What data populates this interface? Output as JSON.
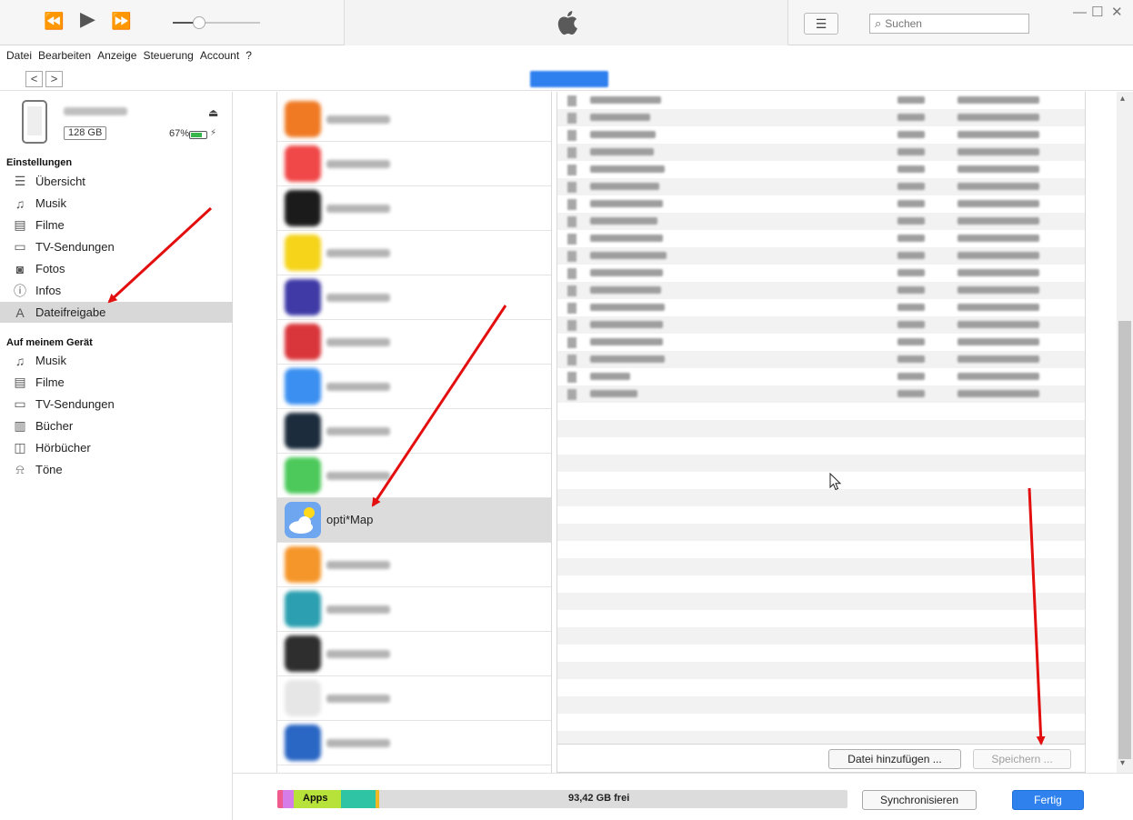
{
  "window": {
    "controls": {
      "minimize": "—",
      "maximize": "☐",
      "close": "✕"
    }
  },
  "toolbar": {
    "rewind_icon": "⏪",
    "play_icon": "▶",
    "forward_icon": "⏩",
    "volume_level": 0.3,
    "list_view_icon": "☰",
    "search": {
      "icon": "⌕",
      "placeholder": "Suchen"
    }
  },
  "menu": [
    "Datei",
    "Bearbeiten",
    "Anzeige",
    "Steuerung",
    "Account",
    "?"
  ],
  "nav": {
    "back": "<",
    "forward": ">"
  },
  "device": {
    "capacity": "128 GB",
    "battery": "67%",
    "battery_level": 0.67,
    "eject_icon": "⏏",
    "charge_icon": "⚡"
  },
  "sidebar": {
    "settings_heading": "Einstellungen",
    "settings_items": [
      {
        "label": "Übersicht",
        "icon": "summary-icon",
        "glyph": "☰"
      },
      {
        "label": "Musik",
        "icon": "music-icon",
        "glyph": "♫"
      },
      {
        "label": "Filme",
        "icon": "film-icon",
        "glyph": "▤"
      },
      {
        "label": "TV-Sendungen",
        "icon": "tv-icon",
        "glyph": "▭"
      },
      {
        "label": "Fotos",
        "icon": "camera-icon",
        "glyph": "◙"
      },
      {
        "label": "Infos",
        "icon": "info-icon",
        "glyph": "ⓘ"
      },
      {
        "label": "Dateifreigabe",
        "icon": "app-store-icon",
        "glyph": "A",
        "selected": true
      }
    ],
    "device_heading": "Auf meinem Gerät",
    "device_items": [
      {
        "label": "Musik",
        "icon": "music-icon",
        "glyph": "♫"
      },
      {
        "label": "Filme",
        "icon": "film-icon",
        "glyph": "▤"
      },
      {
        "label": "TV-Sendungen",
        "icon": "tv-icon",
        "glyph": "▭"
      },
      {
        "label": "Bücher",
        "icon": "book-icon",
        "glyph": "▥"
      },
      {
        "label": "Hörbücher",
        "icon": "audiobook-icon",
        "glyph": "◫"
      },
      {
        "label": "Töne",
        "icon": "bell-icon",
        "glyph": "⍾"
      }
    ]
  },
  "apps": {
    "selected_label": "opti*Map",
    "icon_colors": [
      "#f07a24",
      "#f04848",
      "#1b1b1b",
      "#f5d41a",
      "#3f3aa6",
      "#d9363b",
      "#3a8ff0",
      "#1c2c3c",
      "#4cc95a",
      "#7eb7f5",
      "#f5962a",
      "#2c9fb0",
      "#2e2e2e",
      "#e6e6e6",
      "#2a66c4"
    ]
  },
  "files": {
    "rows": 18,
    "add_button": "Datei hinzufügen ...",
    "save_button": "Speichern ..."
  },
  "storage": {
    "apps_label": "Apps",
    "free_label": "93,42 GB frei",
    "segments": [
      {
        "color": "#f05a8c"
      },
      {
        "color": "#d57ce8"
      },
      {
        "color": "#b6e23a"
      },
      {
        "color": "#2fc4a4"
      },
      {
        "color": "#f0b822"
      }
    ]
  },
  "buttons": {
    "sync": "Synchronisieren",
    "done": "Fertig"
  },
  "colors": {
    "accent": "#2f82ee",
    "annotation_arrow": "#e30e0e",
    "selection": "#d8d8d8"
  }
}
